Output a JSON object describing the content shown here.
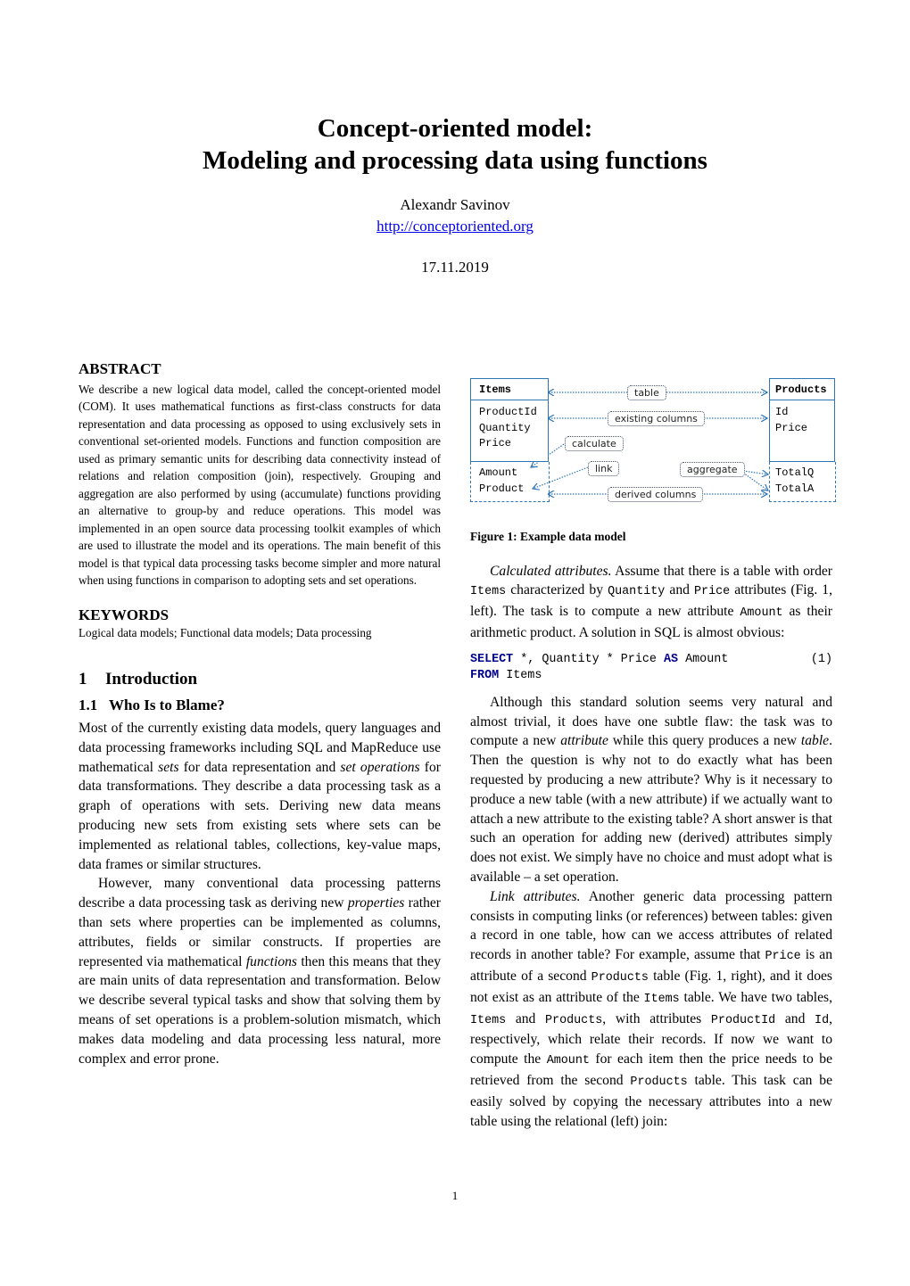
{
  "header": {
    "title_line1": "Concept-oriented model:",
    "title_line2": "Modeling and processing data using functions",
    "author": "Alexandr Savinov",
    "url": "http://conceptoriented.org",
    "date": "17.11.2019"
  },
  "abstract": {
    "heading": "ABSTRACT",
    "text": "We describe a new logical data model, called the concept-oriented model (COM). It uses mathematical functions as first-class constructs for data representation and data processing as opposed to using exclusively sets in conventional set-oriented models. Functions and function composition are used as primary semantic units for describing data connectivity instead of relations and relation composition (join), respectively. Grouping and aggregation are also performed by using (accumulate) functions providing an alternative to group-by and reduce operations. This model was implemented in an open source data processing toolkit examples of which are used to illustrate the model and its operations. The main benefit of this model is that typical data processing tasks become simpler and more natural when using functions in comparison to adopting sets and set operations."
  },
  "keywords": {
    "heading": "KEYWORDS",
    "text": "Logical data models; Functional data models; Data processing"
  },
  "section1": {
    "number": "1",
    "title": "Introduction",
    "sub_number": "1.1",
    "sub_title": "Who Is to Blame?",
    "p1": {
      "a": "Most of the currently existing data models, query languages and data processing frameworks including SQL and MapReduce use mathematical ",
      "em1": "sets",
      "b": " for data representation and ",
      "em2": "set operations",
      "c": " for data transformations. They describe a data processing task as a graph of operations with sets. Deriving new data means producing new sets from existing sets where sets can be implemented as relational tables, collections, key-value maps, data frames or similar structures."
    },
    "p2": {
      "a": "However, many conventional data processing patterns describe a data processing task as deriving new ",
      "em1": "properties",
      "b": " rather than sets where properties can be implemented as columns, attributes, fields or similar constructs. If properties are represented via mathematical ",
      "em2": "functions",
      "c": " then this means that they are main units of data representation and transformation. Below we describe several typical tasks and show that solving them by means of set operations is a problem-solution mismatch, which makes data modeling and data processing less natural, more complex and error prone."
    }
  },
  "figure1": {
    "caption": "Figure 1: Example data model",
    "items_table": {
      "name": "Items",
      "columns": [
        "ProductId",
        "Quantity",
        "Price"
      ],
      "derived": [
        "Amount",
        "Product"
      ]
    },
    "products_table": {
      "name": "Products",
      "columns": [
        "Id",
        "Price"
      ],
      "derived": [
        "TotalQ",
        "TotalA"
      ]
    },
    "labels": {
      "table": "table",
      "existing": "existing columns",
      "calculate": "calculate",
      "link": "link",
      "aggregate": "aggregate",
      "derived": "derived columns"
    },
    "line_color": "#2e75b6"
  },
  "right": {
    "p1": {
      "em": "Calculated attributes.",
      "a": " Assume that there is a table with order ",
      "m1": "Items",
      "b": " characterized by ",
      "m2": "Quantity",
      "c": " and ",
      "m3": "Price",
      "d": " attributes (Fig. 1, left). The task is to compute a new attribute ",
      "m4": "Amount",
      "e": " as their arithmetic product. A solution in SQL is almost obvious:"
    },
    "code": {
      "kw1": "SELECT",
      "t1": " *, Quantity * Price ",
      "kw2": "AS",
      "t2": " Amount",
      "eqnum": "(1)",
      "kw3": "FROM",
      "t3": " Items"
    },
    "p2": {
      "a": "Although this standard solution seems very natural and almost trivial, it does have one subtle flaw: the task was to compute a new ",
      "em1": "attribute",
      "b": " while this query produces a new ",
      "em2": "table",
      "c": ". Then the question is why not to do exactly what has been requested by producing a new attribute? Why is it necessary to produce a new table (with a new attribute) if we actually want to attach a new attribute to the existing table? A short answer is that such an operation for adding new (derived) attributes simply does not exist. We simply have no choice and must adopt what is available – a set operation."
    },
    "p3": {
      "em": "Link attributes.",
      "a": " Another generic data processing pattern consists in computing links (or references) between tables: given a record in one table, how can we access attributes of related records in another table? For example, assume that ",
      "m1": "Price",
      "b": " is an attribute of a second ",
      "m2": "Products",
      "c": " table (Fig. 1, right), and it does not exist as an attribute of the ",
      "m3": "Items",
      "d": " table. We have two tables, ",
      "m4": "Items",
      "e": " and ",
      "m5": "Products",
      "f": ", with attributes ",
      "m6": "ProductId",
      "g": " and ",
      "m7": "Id",
      "h": ", respectively, which relate their records. If now we want to compute the ",
      "m8": "Amount",
      "i": " for each item then the price needs to be retrieved from the second ",
      "m9": "Products",
      "j": " table. This task can be easily solved by copying the necessary attributes into a new table using the relational (left) join:"
    }
  },
  "footer": {
    "page_number": "1"
  }
}
